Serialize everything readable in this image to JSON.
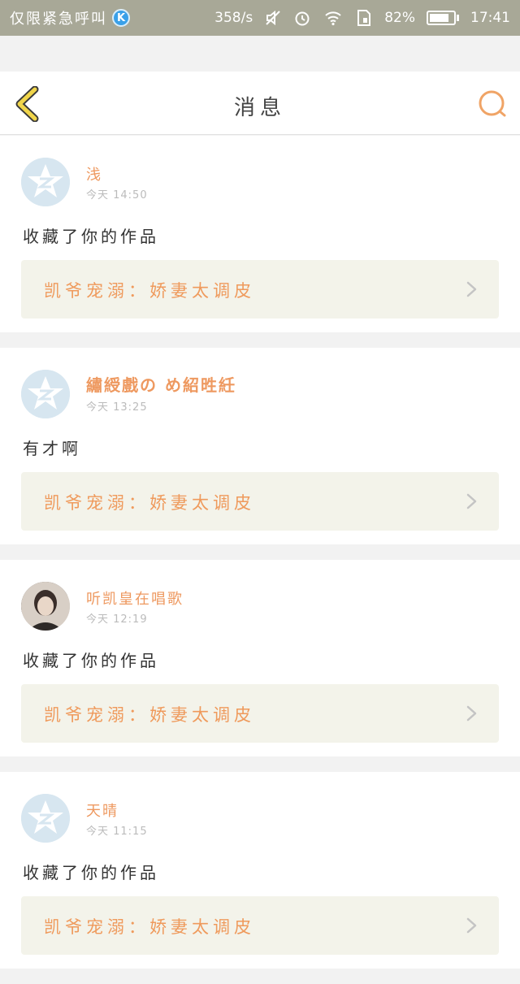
{
  "status_bar": {
    "carrier": "仅限紧急呼叫",
    "app_badge": "K",
    "speed": "358/s",
    "battery": "82%",
    "battery_level": 0.82,
    "time": "17:41",
    "icons": [
      "mute-icon",
      "alarm-icon",
      "wifi-icon",
      "sim-icon",
      "battery-icon"
    ]
  },
  "header": {
    "title": "消息",
    "back_icon": "chevron-left-icon",
    "search_icon": "search-icon",
    "accent": "#f0c84a"
  },
  "colors": {
    "username": "#ee9960",
    "work_label": "#ef9a5c",
    "work_bg": "#f3f3ea"
  },
  "messages": [
    {
      "avatar": "default-qq-avatar",
      "username": "浅",
      "time": "今天 14:50",
      "text": "收藏了你的作品",
      "work": "凯爷宠溺：娇妻太调皮"
    },
    {
      "avatar": "default-qq-avatar",
      "username": "繡綬戲の め紹甠紝",
      "time": "今天 13:25",
      "text": "有才啊",
      "work": "凯爷宠溺：娇妻太调皮"
    },
    {
      "avatar": "photo-avatar",
      "username": "听凯皇在唱歌",
      "time": "今天 12:19",
      "text": "收藏了你的作品",
      "work": "凯爷宠溺：娇妻太调皮"
    },
    {
      "avatar": "default-qq-avatar",
      "username": "天晴",
      "time": "今天 11:15",
      "text": "收藏了你的作品",
      "work": "凯爷宠溺：娇妻太调皮"
    }
  ]
}
